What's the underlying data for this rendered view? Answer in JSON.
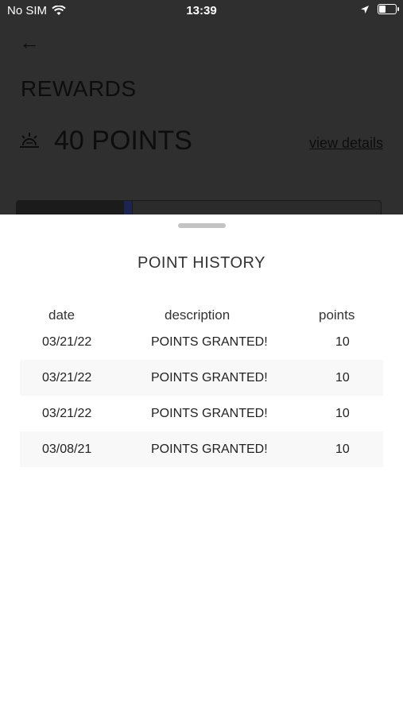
{
  "status_bar": {
    "carrier": "No SIM",
    "time": "13:39"
  },
  "background_page": {
    "title": "REWARDS",
    "points_label": "40 POINTS",
    "view_details": "view details"
  },
  "sheet": {
    "title": "POINT HISTORY",
    "columns": {
      "date": "date",
      "description": "description",
      "points": "points"
    },
    "rows": [
      {
        "date": "03/21/22",
        "description": "POINTS GRANTED!",
        "points": "10"
      },
      {
        "date": "03/21/22",
        "description": "POINTS GRANTED!",
        "points": "10"
      },
      {
        "date": "03/21/22",
        "description": "POINTS GRANTED!",
        "points": "10"
      },
      {
        "date": "03/08/21",
        "description": "POINTS GRANTED!",
        "points": "10"
      }
    ]
  }
}
